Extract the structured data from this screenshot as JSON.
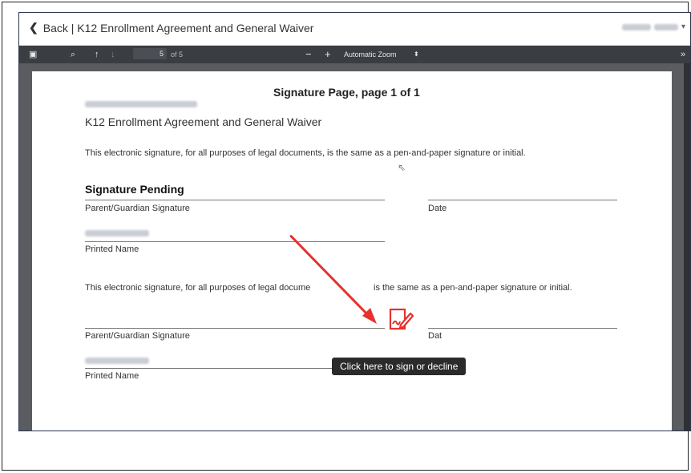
{
  "header": {
    "back_label": "Back | K12 Enrollment Agreement and General Waiver"
  },
  "toolbar": {
    "page_number": "5",
    "page_total": "of 5",
    "zoom_out": "−",
    "zoom_in": "+",
    "zoom_label": "Automatic Zoom",
    "more": "»"
  },
  "document": {
    "title": "Signature Page, page 1 of 1",
    "agreement_name": "K12 Enrollment Agreement and General Waiver",
    "disclaimer": "This electronic signature, for all purposes of legal documents, is the same as a pen-and-paper signature or initial.",
    "signature_status": "Signature Pending",
    "sig_label": "Parent/Guardian Signature",
    "date_label": "Date",
    "printed_name_label": "Printed Name",
    "disclaimer_2_pre": "This electronic signature, for all purposes of legal docume",
    "disclaimer_2_post": "is the same as a pen-and-paper signature or initial.",
    "sig_label_2": "Parent/Guardian Signature",
    "date_label_2": "Dat",
    "printed_name_label_2": "Printed Name"
  },
  "tooltip": {
    "text": "Click here to sign or decline"
  },
  "colors": {
    "accent_red": "#e5322d",
    "toolbar_bg": "#3a3d42",
    "viewer_bg": "#5a5c60"
  }
}
